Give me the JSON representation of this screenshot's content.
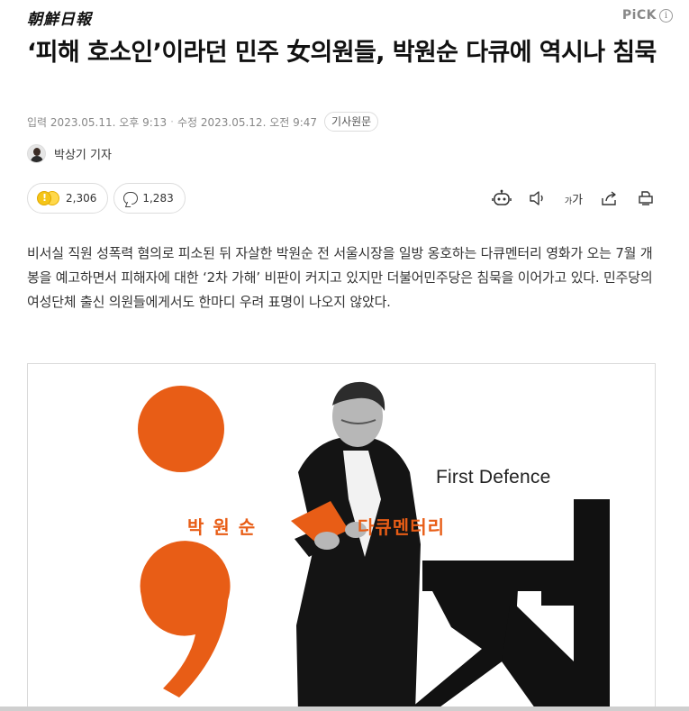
{
  "header": {
    "press_name": "朝鮮日報",
    "pick_label": "PiCK",
    "pick_info": "i"
  },
  "article": {
    "headline": "‘피해 호소인’이라던 민주 女의원들, 박원순 다큐에 역시나 침묵",
    "published_label": "입력",
    "published": "2023.05.11. 오후 9:13",
    "separator": "·",
    "modified_label": "수정",
    "modified": "2023.05.12. 오전 9:47",
    "original_button": "기사원문",
    "reporter": "박상기 기자",
    "lede": "비서실 직원 성폭력 혐의로 피소된 뒤 자살한 박원순 전 서울시장을 일방 옹호하는 다큐멘터리 영화가 오는 7월 개봉을 예고하면서 피해자에 대한 ‘2차 가해’ 비판이 커지고 있지만 더불어민주당은 침묵을 이어가고 있다. 민주당의 여성단체 출신 의원들에게서도 한마디 우려 표명이 나오지 않았다."
  },
  "reactions": {
    "emoji_count": "2,306",
    "comment_count": "1,283"
  },
  "tools": {
    "font_small": "가",
    "font_large": "가"
  },
  "poster": {
    "left_text": "박원순",
    "right_text": "다큐멘터리",
    "subtitle": "First Defence"
  },
  "colors": {
    "accent_orange": "#e85d16",
    "text_dark": "#111111",
    "meta_gray": "#888888"
  }
}
